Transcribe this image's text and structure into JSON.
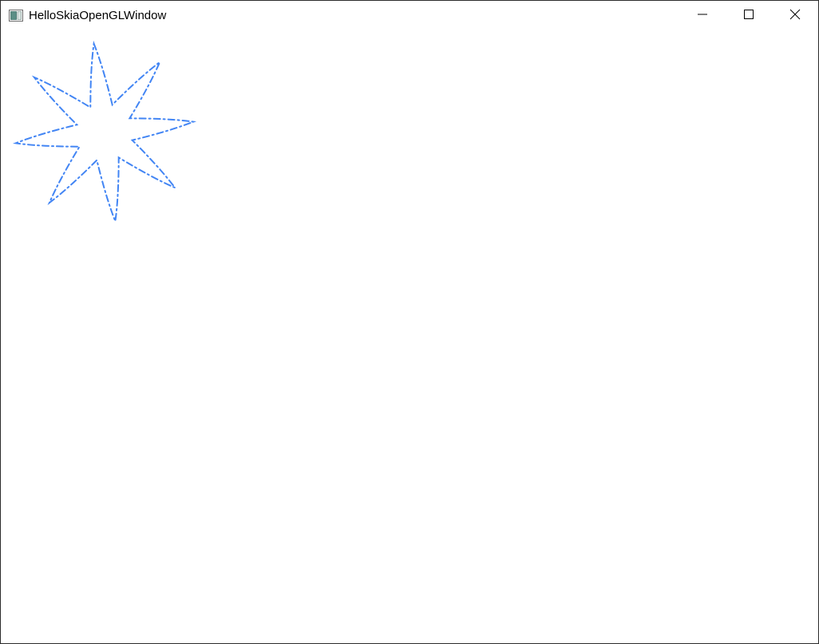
{
  "window": {
    "title": "HelloSkiaOpenGLWindow",
    "app_icon": "window-app-icon",
    "controls": {
      "minimize": "minimize-icon",
      "maximize": "maximize-icon",
      "close": "close-icon"
    }
  },
  "canvas": {
    "shape": "eight-pointed star",
    "stroke_style": "dash-dot",
    "stroke_color": "#4285f4"
  }
}
